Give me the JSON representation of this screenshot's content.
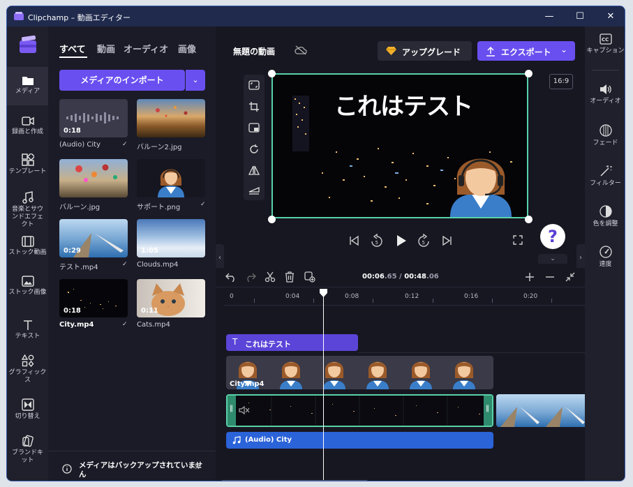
{
  "window": {
    "title": "Clipchamp – 動画エディター"
  },
  "left_rail": [
    {
      "label": "メディア"
    },
    {
      "label": "録画と作成"
    },
    {
      "label": "テンプレート"
    },
    {
      "label": "音楽とサウンドエフェクト"
    },
    {
      "label": "ストック動画"
    },
    {
      "label": "ストック画像"
    },
    {
      "label": "テキスト"
    },
    {
      "label": "グラフィックス"
    },
    {
      "label": "切り替え"
    },
    {
      "label": "ブランドキット"
    }
  ],
  "media": {
    "tabs": [
      "すべて",
      "動画",
      "オーディオ",
      "画像"
    ],
    "import_label": "メディアのインポート",
    "items": [
      {
        "name": "(Audio) City",
        "duration": "0:18"
      },
      {
        "name": "バルーン2.jpg",
        "duration": ""
      },
      {
        "name": "バルーン.jpg",
        "duration": ""
      },
      {
        "name": "サポート.png",
        "duration": ""
      },
      {
        "name": "テスト.mp4",
        "duration": "0:29"
      },
      {
        "name": "Clouds.mp4",
        "duration": "1:05"
      },
      {
        "name": "City.mp4",
        "duration": "0:18"
      },
      {
        "name": "Cats.mp4",
        "duration": "0:11"
      }
    ],
    "backup_text": "メディアはバックアップされていません"
  },
  "header": {
    "project_title": "無題の動画",
    "upgrade_label": "アップグレード",
    "export_label": "エクスポート"
  },
  "preview": {
    "aspect": "16:9",
    "overlay_text": "これはテスト",
    "help": "?"
  },
  "timeline": {
    "current_main": "00:06",
    "current_frac": ".65",
    "sep": " / ",
    "total_main": "00:48",
    "total_frac": ".06",
    "ticks": [
      "0",
      "0:04",
      "0:08",
      "0:12",
      "0:16",
      "0:20"
    ],
    "text_clip": "これはテスト",
    "image_clip": "City.mp4",
    "audio_clip": "(Audio) City"
  },
  "right_rail": [
    {
      "label": "キャプション"
    },
    {
      "label": "オーディオ"
    },
    {
      "label": "フェード"
    },
    {
      "label": "フィルター"
    },
    {
      "label": "色を調整"
    },
    {
      "label": "速度"
    }
  ]
}
